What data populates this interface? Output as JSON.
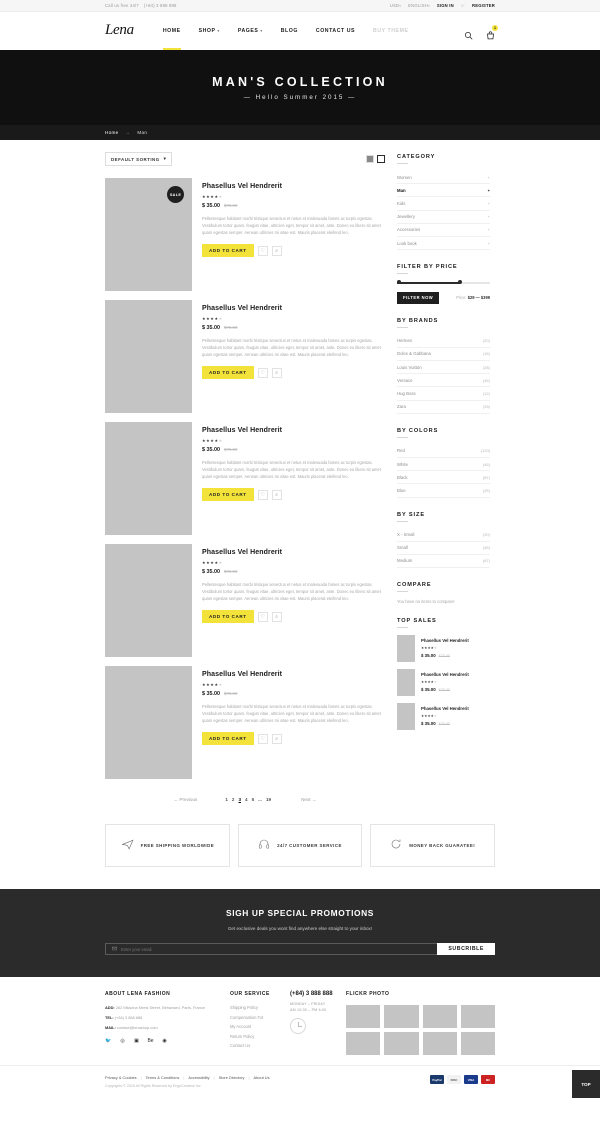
{
  "topbar": {
    "call_text": "Call us free 24/7",
    "phone": "(+84) 3 888 888",
    "currency": "USD",
    "language": "ENGLISH",
    "sign_in": "SIGN IN",
    "or": "or",
    "register": "REGISTER"
  },
  "header": {
    "logo": "Lena",
    "nav": [
      {
        "label": "HOME",
        "active": true,
        "caret": ""
      },
      {
        "label": "SHOP",
        "active": false,
        "caret": "▾"
      },
      {
        "label": "PAGES",
        "active": false,
        "caret": "▾"
      },
      {
        "label": "BLOG",
        "active": false,
        "caret": ""
      },
      {
        "label": "CONTACT US",
        "active": false,
        "caret": ""
      },
      {
        "label": "BUY THEME",
        "active": false,
        "caret": ""
      }
    ],
    "cart_count": "1",
    "search_icon": "search-icon",
    "cart_icon": "shopping-bag-icon"
  },
  "hero": {
    "title": "MAN'S COLLECTION",
    "subtitle": "— Hello Summer 2015 —"
  },
  "breadcrumb": {
    "home": "Home",
    "arrow": "→",
    "current": "Man"
  },
  "toolbar": {
    "sorting_label": "DEFAULT SORTING",
    "sorting_caret": "▾"
  },
  "products": [
    {
      "title": "Phasellus Vel Hendrerit",
      "rating": 4,
      "price": "$ 35.00",
      "old_price": "$75.00",
      "sale": true,
      "sale_label": "SALE",
      "desc": "Pellentesque habitant morbi tristique senectus et netus et malesuada fames ac turpis egestas. Vestibulum tortor quam, feugiat vitae, ultricies eget, tempor sit amet, ante. Donec eu libero sit amet quam egestas semper. Aenean ultricies mi vitae est. Mauris placerat eleifend leo.",
      "cart_label": "ADD TO CART"
    },
    {
      "title": "Phasellus Vel Hendrerit",
      "rating": 4,
      "price": "$ 35.00",
      "old_price": "$75.00",
      "sale": false,
      "sale_label": "SALE",
      "desc": "Pellentesque habitant morbi tristique senectus et netus et malesuada fames ac turpis egestas. Vestibulum tortor quam, feugiat vitae, ultricies eget, tempor sit amet, ante. Donec eu libero sit amet quam egestas semper. Aenean ultricies mi vitae est. Mauris placerat eleifend leo.",
      "cart_label": "ADD TO CART"
    },
    {
      "title": "Phasellus Vel Hendrerit",
      "rating": 4,
      "price": "$ 35.00",
      "old_price": "$75.00",
      "sale": false,
      "sale_label": "SALE",
      "desc": "Pellentesque habitant morbi tristique senectus et netus et malesuada fames ac turpis egestas. Vestibulum tortor quam, feugiat vitae, ultricies eget, tempor sit amet, ante. Donec eu libero sit amet quam egestas semper. Aenean ultricies mi vitae est. Mauris placerat eleifend leo.",
      "cart_label": "ADD TO CART"
    },
    {
      "title": "Phasellus Vel Hendrerit",
      "rating": 4,
      "price": "$ 35.00",
      "old_price": "$75.00",
      "sale": false,
      "sale_label": "SALE",
      "desc": "Pellentesque habitant morbi tristique senectus et netus et malesuada fames ac turpis egestas. Vestibulum tortor quam, feugiat vitae, ultricies eget, tempor sit amet, ante. Donec eu libero sit amet quam egestas semper. Aenean ultricies mi vitae est. Mauris placerat eleifend leo.",
      "cart_label": "ADD TO CART"
    },
    {
      "title": "Phasellus Vel Hendrerit",
      "rating": 4,
      "price": "$ 35.00",
      "old_price": "$75.00",
      "sale": false,
      "sale_label": "SALE",
      "desc": "Pellentesque habitant morbi tristique senectus et netus et malesuada fames ac turpis egestas. Vestibulum tortor quam, feugiat vitae, ultricies eget, tempor sit amet, ante. Donec eu libero sit amet quam egestas semper. Aenean ultricies mi vitae est. Mauris placerat eleifend leo.",
      "cart_label": "ADD TO CART"
    }
  ],
  "pagination": {
    "prev": "← Previous",
    "next": "Next →",
    "pages": [
      "1",
      "2",
      "3",
      "4",
      "5",
      "...",
      "19"
    ],
    "current": "3"
  },
  "sidebar": {
    "category": {
      "title": "CATEGORY",
      "items": [
        {
          "label": "Women",
          "active": false
        },
        {
          "label": "Man",
          "active": true
        },
        {
          "label": "Kids",
          "active": false
        },
        {
          "label": "Jewellery",
          "active": false
        },
        {
          "label": "Accessories",
          "active": false
        },
        {
          "label": "Look book",
          "active": false
        }
      ]
    },
    "price": {
      "title": "FILTER BY PRICE",
      "button": "FILTER NOW",
      "label_prefix": "Price:",
      "range": "$29 — $399",
      "min": 29,
      "max": 399
    },
    "brands": {
      "title": "BY BRANDS",
      "items": [
        {
          "label": "Hermes",
          "count": "(20)"
        },
        {
          "label": "Dolce & Gabbana",
          "count": "(16)"
        },
        {
          "label": "Louis Vuitton",
          "count": "(28)"
        },
        {
          "label": "Versace",
          "count": "(45)"
        },
        {
          "label": "Hug Boss",
          "count": "(12)"
        },
        {
          "label": "Zara",
          "count": "(33)"
        }
      ]
    },
    "colors": {
      "title": "BY COLORS",
      "items": [
        {
          "label": "Red",
          "count": "(120)"
        },
        {
          "label": "White",
          "count": "(45)"
        },
        {
          "label": "Black",
          "count": "(87)"
        },
        {
          "label": "Blue",
          "count": "(25)"
        }
      ]
    },
    "size": {
      "title": "BY SIZE",
      "items": [
        {
          "label": "X - Small",
          "count": "(20)"
        },
        {
          "label": "Small",
          "count": "(45)"
        },
        {
          "label": "Medium",
          "count": "(87)"
        }
      ]
    },
    "compare": {
      "title": "COMPARE",
      "empty_text": "You have no items to compare!"
    },
    "top_sales": {
      "title": "TOP SALES",
      "items": [
        {
          "title": "Phasellus Vel Hendrerit",
          "rating": 4,
          "price": "$ 35.00",
          "old_price": "$75.00"
        },
        {
          "title": "Phasellus Vel Hendrerit",
          "rating": 4,
          "price": "$ 35.00",
          "old_price": "$75.00"
        },
        {
          "title": "Phasellus Vel Hendrerit",
          "rating": 4,
          "price": "$ 35.00",
          "old_price": "$75.00"
        }
      ]
    }
  },
  "features": [
    {
      "label": "FREE SHIPPING WORLDWIDE",
      "icon": "airplane-icon"
    },
    {
      "label": "24/7 CUSTOMER SERVICE",
      "icon": "headphones-icon"
    },
    {
      "label": "MONEY BACK GUARATEE!",
      "icon": "refresh-icon"
    }
  ],
  "newsletter": {
    "title": "SIGH UP SPECIAL PROMOTIONS",
    "subtitle": "Get exclusive deals you wont find anywhere else straight to your inbox!",
    "placeholder": "Enter your email",
    "value": "",
    "button": "SUBCRIBLE"
  },
  "footer": {
    "about": {
      "title": "ABOUT LENA FASHION",
      "add_label": "ADD:",
      "add_value": "262 Milacina Mrest Street, Behansed, Paris, France",
      "tel_label": "TEL:",
      "tel_value": "(+84) 3 888 888",
      "mail_label": "MAIL:",
      "mail_value": "contact@lenashop.com",
      "socials": [
        "twitter-icon",
        "pinterest-icon",
        "facebook-icon",
        "behance-icon",
        "dribbble-icon"
      ]
    },
    "service": {
      "title": "OUR SERVICE",
      "links": [
        "Shipping Policy",
        "Compensation Fot",
        "My Account",
        "Return Policy",
        "Contact Us"
      ]
    },
    "hours": {
      "phone": "(+84) 3 888 888",
      "days": "MONDAY – FRIDAY",
      "times": "AM 10:00 – PM 6:00"
    },
    "flickr": {
      "title": "FLICKR PHOTO",
      "cells": 8
    }
  },
  "bottombar": {
    "links": [
      "Privacy & Cookies",
      "Terms & Conditions",
      "Accessibility",
      "Store Directory",
      "About Us"
    ],
    "divider": "|",
    "copyright": "Copyrights © 2015 All Rights Reserved by EngoCreative Inc",
    "payments": [
      {
        "name": "paypal",
        "color": "#1a3a6b"
      },
      {
        "name": "discover",
        "color": "#f2f2f2"
      },
      {
        "name": "visa",
        "color": "#1a3a8b"
      },
      {
        "name": "mastercard",
        "color": "#cc2222"
      }
    ],
    "to_top": "TOP"
  }
}
